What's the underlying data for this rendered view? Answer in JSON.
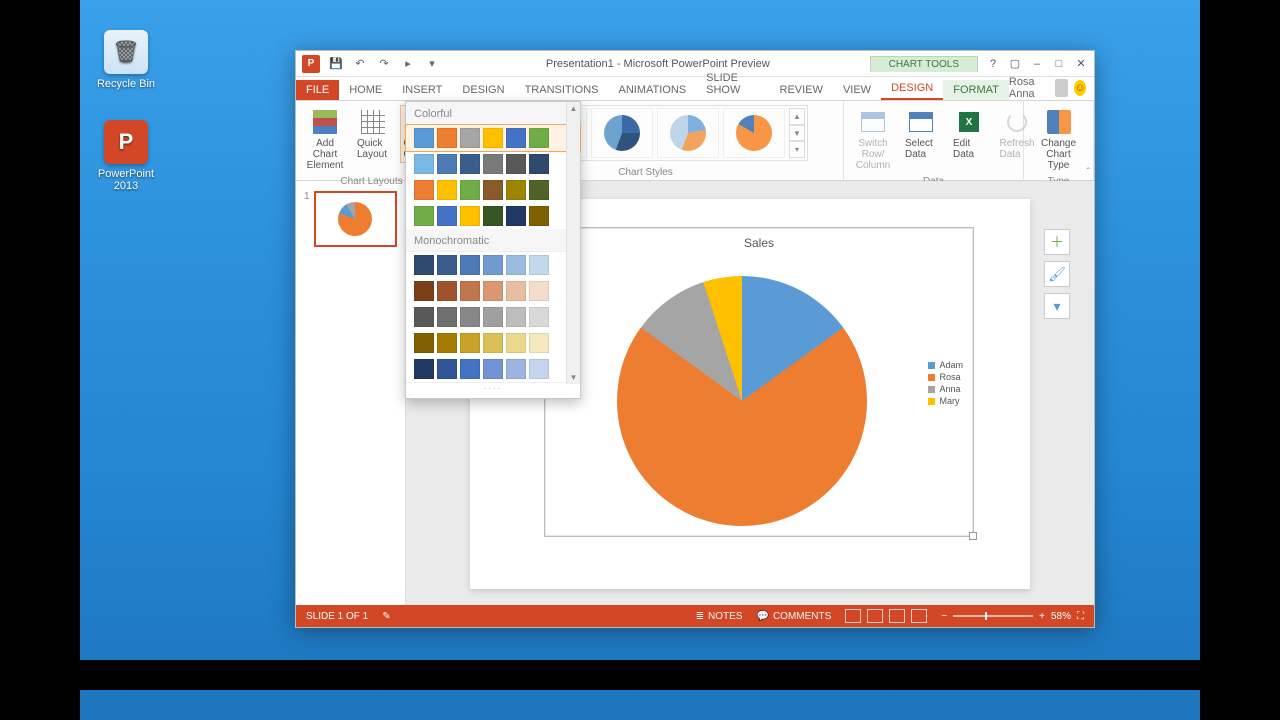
{
  "desktop": {
    "recycle": "Recycle Bin",
    "ppt_shortcut": "PowerPoint 2013"
  },
  "titlebar": {
    "title": "Presentation1 - Microsoft PowerPoint Preview",
    "context_tab": "CHART TOOLS"
  },
  "user": {
    "name": "Rosa Anna"
  },
  "tabs": {
    "file": "FILE",
    "home": "HOME",
    "insert": "INSERT",
    "design": "DESIGN",
    "transitions": "TRANSITIONS",
    "animations": "ANIMATIONS",
    "slideshow": "SLIDE SHOW",
    "review": "REVIEW",
    "view": "VIEW",
    "ctx_design": "DESIGN",
    "ctx_format": "FORMAT"
  },
  "ribbon": {
    "layouts": {
      "add_elem": "Add Chart Element",
      "quick": "Quick Layout",
      "colors": "Change Colors",
      "label": "Chart Layouts"
    },
    "styles_label": "Chart Styles",
    "data": {
      "switch": "Switch Row/ Column",
      "select": "Select Data",
      "edit": "Edit Data",
      "refresh": "Refresh Data",
      "label": "Data"
    },
    "type": {
      "change": "Change Chart Type",
      "label": "Type"
    }
  },
  "palette": {
    "colorful": "Colorful",
    "mono": "Monochromatic",
    "colorful_rows": [
      [
        "#5b9bd5",
        "#ed7d31",
        "#a5a5a5",
        "#ffc000",
        "#4472c4",
        "#70ad47"
      ],
      [
        "#7cb8e5",
        "#4e7ab5",
        "#3b5c8c",
        "#7a7a7a",
        "#595959",
        "#2e4a6f"
      ],
      [
        "#ed7d31",
        "#ffc000",
        "#70ad47",
        "#8b5a2b",
        "#9e8500",
        "#4f6228"
      ],
      [
        "#70ad47",
        "#4472c4",
        "#ffc000",
        "#375623",
        "#1f3864",
        "#806000"
      ]
    ],
    "mono_rows": [
      [
        "#2e4a6f",
        "#3b5c8c",
        "#4e7ab5",
        "#6f9bd1",
        "#9bbce0",
        "#c3d8ee"
      ],
      [
        "#7b3f1a",
        "#a0522d",
        "#c2764b",
        "#d99872",
        "#e8bda1",
        "#f3dccb"
      ],
      [
        "#595959",
        "#6f6f6f",
        "#878787",
        "#a0a0a0",
        "#bdbdbd",
        "#d9d9d9"
      ],
      [
        "#806000",
        "#a67c00",
        "#c9a227",
        "#dcbf55",
        "#ead98c",
        "#f4e9bd"
      ],
      [
        "#1f3864",
        "#2f5597",
        "#4472c4",
        "#7093d4",
        "#9db4e2",
        "#c5d3ef"
      ]
    ]
  },
  "slide": {
    "thumb_num": "1"
  },
  "status": {
    "slide": "SLIDE 1 OF 1",
    "notes": "NOTES",
    "comments": "COMMENTS",
    "zoom": "58%"
  },
  "chart_data": {
    "type": "pie",
    "title": "Sales",
    "categories": [
      "Adam",
      "Rosa",
      "Anna",
      "Mary"
    ],
    "values": [
      15,
      70,
      10,
      5
    ],
    "colors": [
      "#5b9bd5",
      "#ed7d31",
      "#a5a5a5",
      "#ffc000"
    ]
  }
}
